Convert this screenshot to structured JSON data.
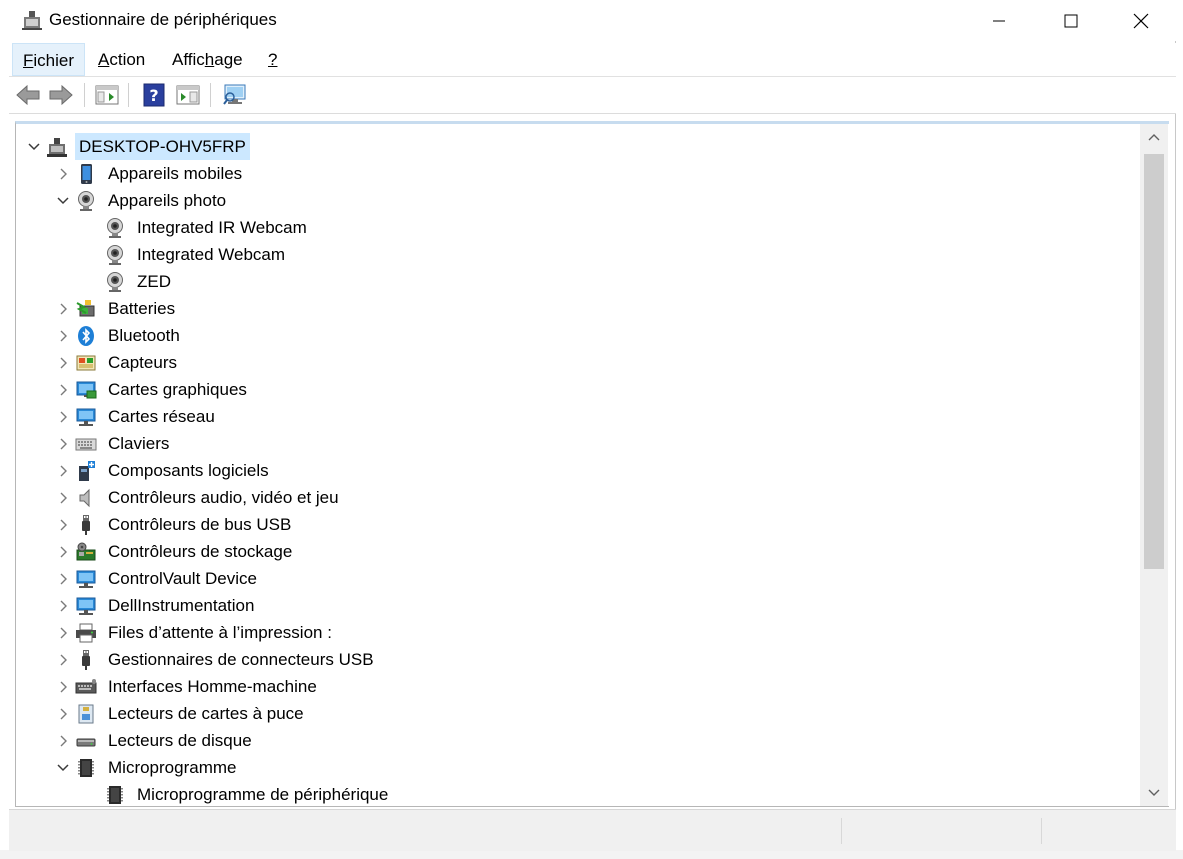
{
  "window": {
    "title": "Gestionnaire de périphériques",
    "minimize_label": "",
    "maximize_label": "",
    "close_label": ""
  },
  "menubar": {
    "items": [
      {
        "label_u": "F",
        "label_rest": "ichier"
      },
      {
        "label_u": "A",
        "label_rest": "ction"
      },
      {
        "label_pre": "Affic",
        "label_u": "h",
        "label_rest": "age"
      },
      {
        "label_u": "?",
        "label_rest": ""
      }
    ]
  },
  "toolbar": {
    "icons": [
      "back-arrow-icon",
      "forward-arrow-icon",
      "show-hide-console-tree-icon",
      "help-icon",
      "properties-pane-icon",
      "scan-hardware-icon"
    ]
  },
  "tree": {
    "nodes": [
      {
        "label": "DESKTOP-OHV5FRP",
        "level": 0,
        "expand": "expanded",
        "icon": "computer-icon",
        "selected": true
      },
      {
        "label": "Appareils mobiles",
        "level": 1,
        "expand": "collapsed",
        "icon": "mobile-device-icon"
      },
      {
        "label": "Appareils photo",
        "level": 1,
        "expand": "expanded",
        "icon": "webcam-icon"
      },
      {
        "label": "Integrated IR Webcam",
        "level": 2,
        "expand": "none",
        "icon": "webcam-icon"
      },
      {
        "label": "Integrated Webcam",
        "level": 2,
        "expand": "none",
        "icon": "webcam-icon"
      },
      {
        "label": "ZED",
        "level": 2,
        "expand": "none",
        "icon": "webcam-icon"
      },
      {
        "label": "Batteries",
        "level": 1,
        "expand": "collapsed",
        "icon": "battery-icon"
      },
      {
        "label": "Bluetooth",
        "level": 1,
        "expand": "collapsed",
        "icon": "bluetooth-icon"
      },
      {
        "label": "Capteurs",
        "level": 1,
        "expand": "collapsed",
        "icon": "sensor-icon"
      },
      {
        "label": "Cartes graphiques",
        "level": 1,
        "expand": "collapsed",
        "icon": "display-adapter-icon"
      },
      {
        "label": "Cartes réseau",
        "level": 1,
        "expand": "collapsed",
        "icon": "network-adapter-icon"
      },
      {
        "label": "Claviers",
        "level": 1,
        "expand": "collapsed",
        "icon": "keyboard-icon"
      },
      {
        "label": "Composants logiciels",
        "level": 1,
        "expand": "collapsed",
        "icon": "software-component-icon"
      },
      {
        "label": "Contrôleurs audio, vidéo et jeu",
        "level": 1,
        "expand": "collapsed",
        "icon": "speaker-icon"
      },
      {
        "label": "Contrôleurs de bus USB",
        "level": 1,
        "expand": "collapsed",
        "icon": "usb-icon"
      },
      {
        "label": "Contrôleurs de stockage",
        "level": 1,
        "expand": "collapsed",
        "icon": "storage-controller-icon"
      },
      {
        "label": "ControlVault Device",
        "level": 1,
        "expand": "collapsed",
        "icon": "monitor-icon"
      },
      {
        "label": "DellInstrumentation",
        "level": 1,
        "expand": "collapsed",
        "icon": "monitor-icon"
      },
      {
        "label": "Files d’attente à l’impression :",
        "level": 1,
        "expand": "collapsed",
        "icon": "printer-icon"
      },
      {
        "label": "Gestionnaires de connecteurs USB",
        "level": 1,
        "expand": "collapsed",
        "icon": "usb-icon"
      },
      {
        "label": "Interfaces Homme-machine",
        "level": 1,
        "expand": "collapsed",
        "icon": "hid-icon"
      },
      {
        "label": "Lecteurs de cartes à puce",
        "level": 1,
        "expand": "collapsed",
        "icon": "smart-card-reader-icon"
      },
      {
        "label": "Lecteurs de disque",
        "level": 1,
        "expand": "collapsed",
        "icon": "disk-drive-icon"
      },
      {
        "label": "Microprogramme",
        "level": 1,
        "expand": "expanded",
        "icon": "firmware-chip-icon"
      },
      {
        "label": "Microprogramme de périphérique",
        "level": 2,
        "expand": "none",
        "icon": "firmware-chip-icon"
      }
    ]
  },
  "colors": {
    "selection": "#cce8ff",
    "menu_active": "#e5f1fb",
    "accent_blue": "#1e7fd6"
  }
}
